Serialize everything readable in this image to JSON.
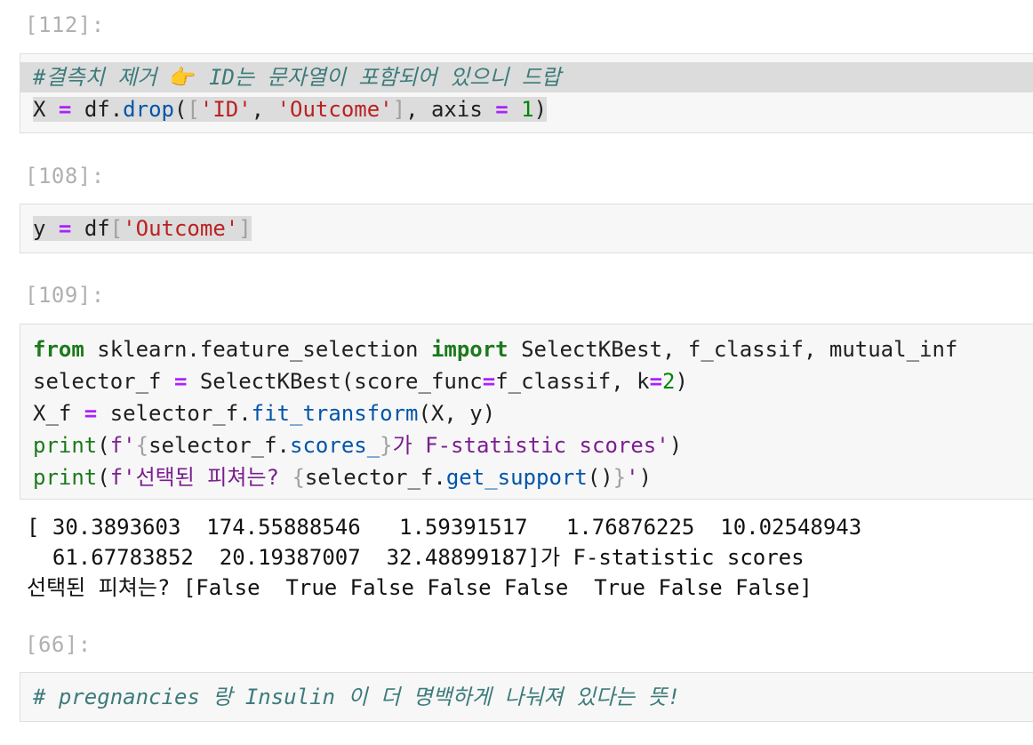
{
  "cells": [
    {
      "prompt": "[112]:",
      "lines": [
        {
          "comment_hash": "#",
          "comment_text": "결측치 제거",
          "emoji": "👉",
          "comment_text2": " ID는 문자열이 포함되어 있으니 드랍"
        },
        {
          "t1": "X",
          "op1": "=",
          "t2": "df",
          "t3": ".",
          "fn": "drop",
          "t4": "(",
          "b1": "[",
          "s1": "'ID'",
          "t5": ", ",
          "s2": "'Outcome'",
          "b2": "]",
          "t6": ", axis ",
          "op2": "=",
          "t7": " ",
          "num": "1",
          "t8": ")"
        }
      ]
    },
    {
      "prompt": "[108]:",
      "lines": [
        {
          "t1": "y",
          "op1": "=",
          "t2": "df",
          "b1": "[",
          "s1": "'Outcome'",
          "b2": "]"
        }
      ]
    },
    {
      "prompt": "[109]:",
      "lines": [
        {
          "kw1": "from",
          "t1": " sklearn.feature_selection ",
          "kw2": "import",
          "t2": " SelectKBest, f_classif, mutual_inf"
        },
        {
          "t1": "selector_f ",
          "op1": "=",
          "t2": " SelectKBest(score_func",
          "op2": "=",
          "t3": "f_classif, k",
          "op3": "=",
          "num": "2",
          "t4": ")"
        },
        {
          "t1": "X_f ",
          "op1": "=",
          "t2": " selector_f.",
          "fn": "fit_transform",
          "t3": "(X, y)"
        },
        {
          "bltin": "print",
          "t1": "(",
          "f1": "f'",
          "b1": "{",
          "t2": "selector_f.",
          "fn": "scores_",
          "b2": "}",
          "f2": "가 F-statistic scores'",
          "t3": ")"
        },
        {
          "bltin": "print",
          "t1": "(",
          "f1": "f'선택된 피쳐는? ",
          "b1": "{",
          "t2": "selector_f.",
          "fn": "get_support",
          "t3": "()",
          "b2": "}",
          "f2": "'",
          "t4": ")"
        }
      ],
      "output": [
        "[ 30.3893603  174.55888546   1.59391517   1.76876225  10.02548943",
        "  61.67783852  20.19387007  32.48899187]가 F-statistic scores",
        "선택된 피쳐는? [False  True False False False  True False False]"
      ]
    },
    {
      "prompt": "[66]:",
      "lines": [
        {
          "comment": "# pregnancies 랑 Insulin 이 더 명백하게 나눠져 있다는 뜻!"
        }
      ]
    }
  ]
}
